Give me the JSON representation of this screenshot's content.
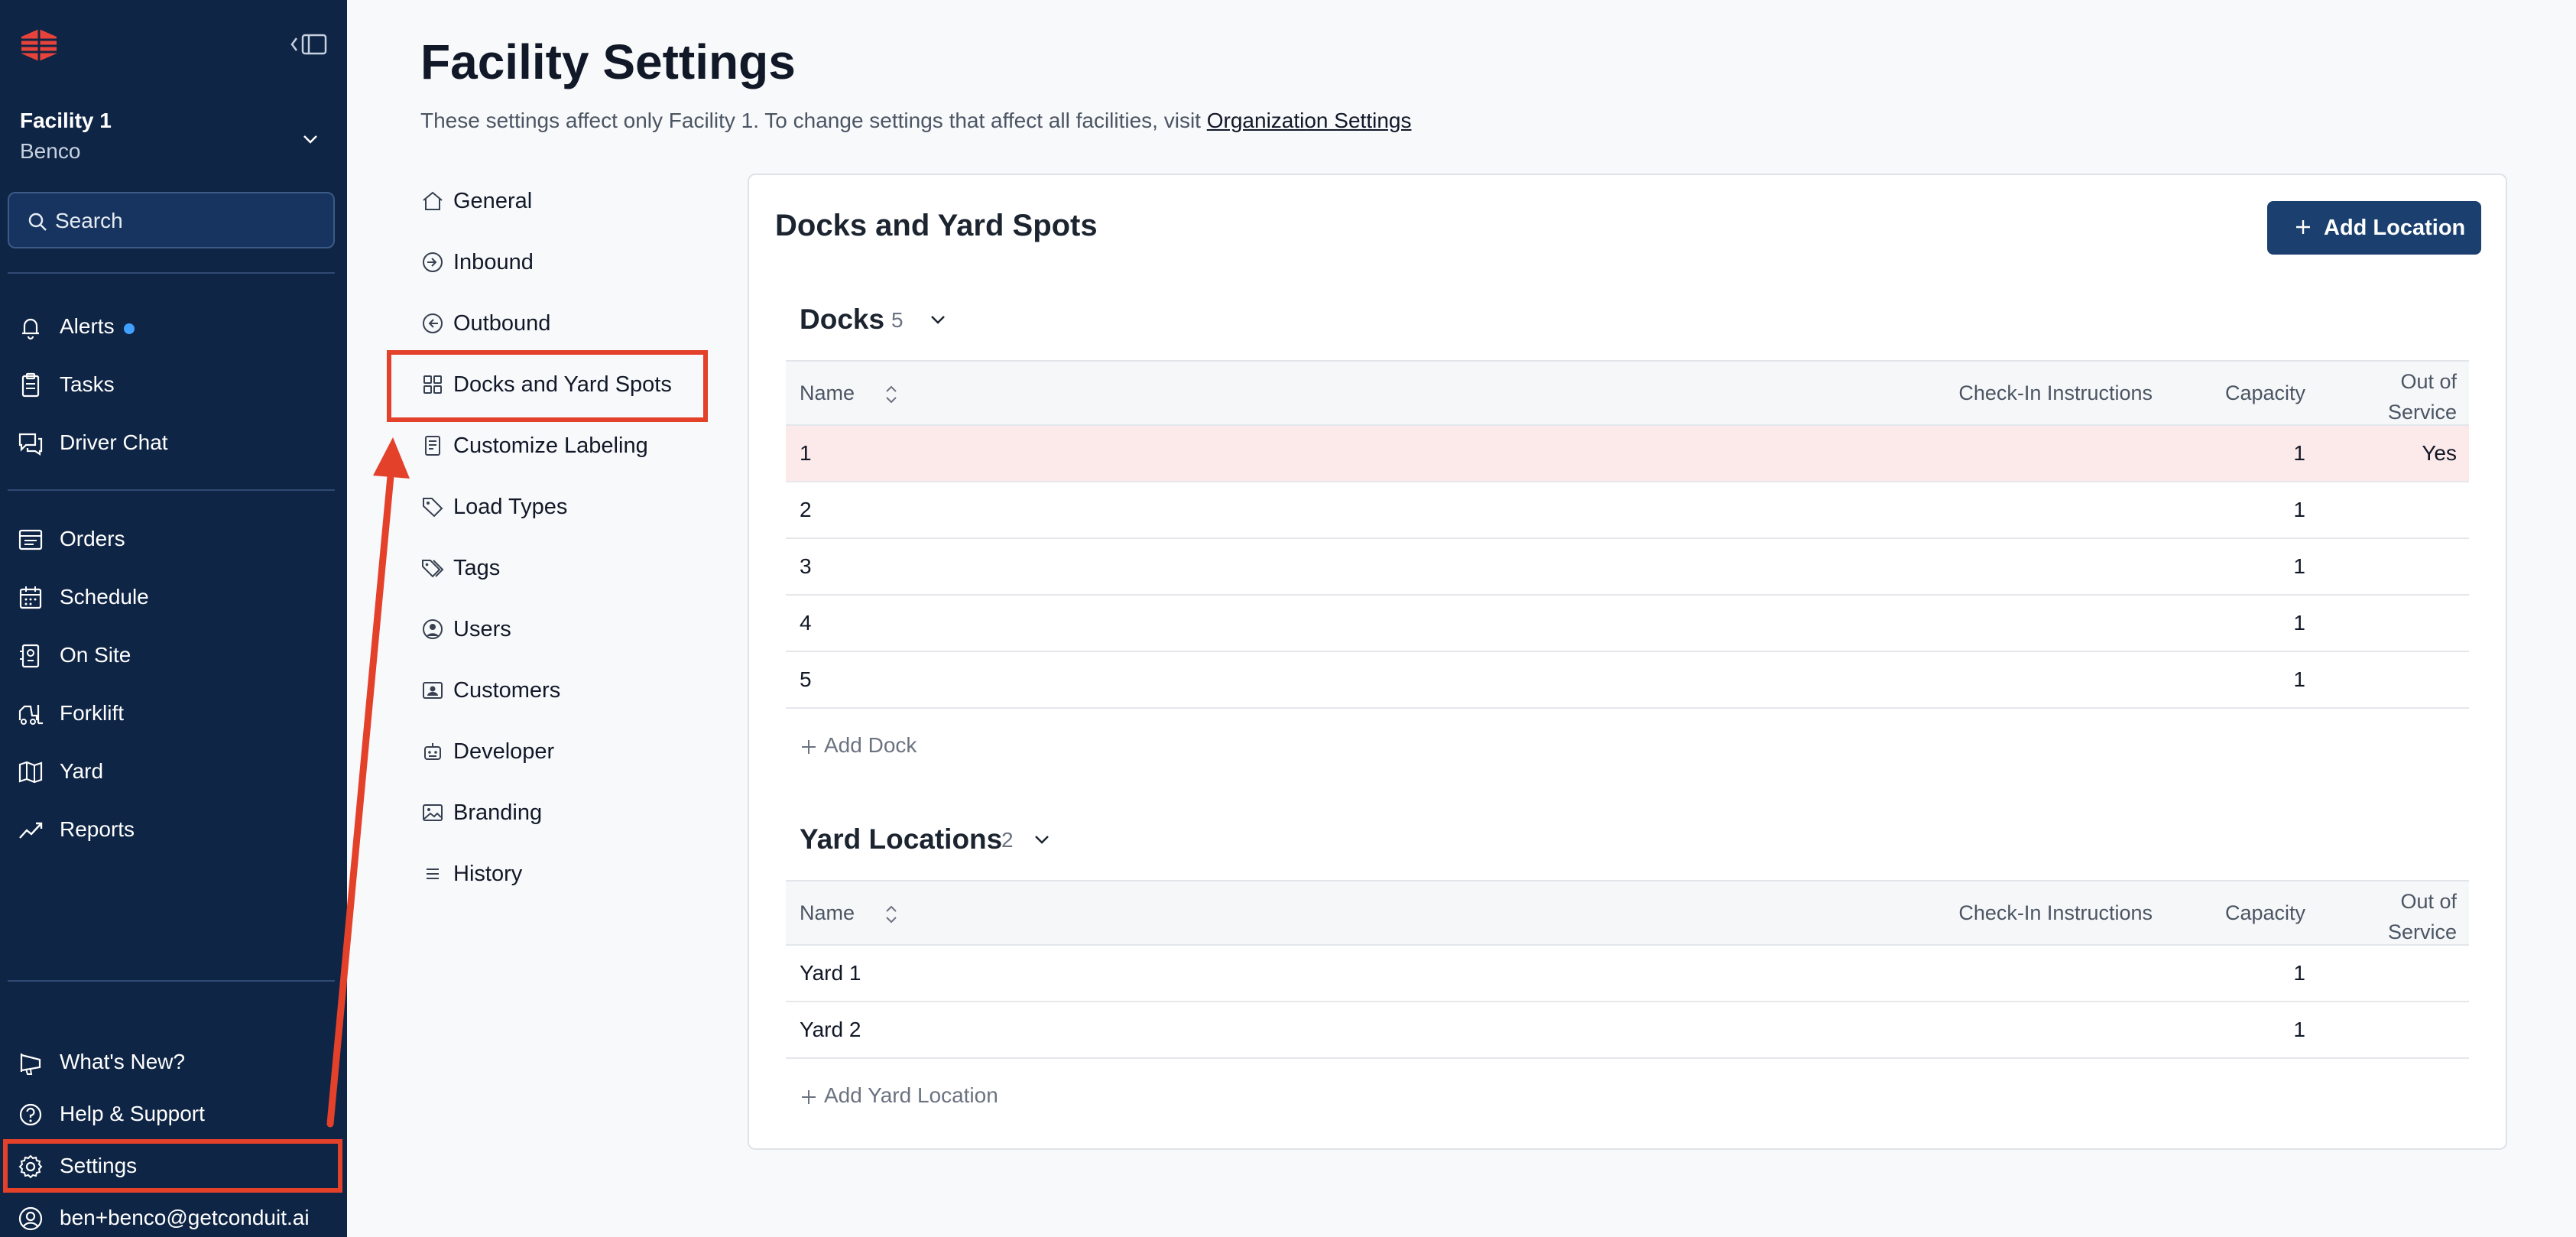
{
  "sidebar": {
    "facility": {
      "name": "Facility 1",
      "org": "Benco"
    },
    "search": {
      "label": "Search"
    },
    "primary_items": [
      {
        "label": "Alerts",
        "icon": "bell-icon",
        "unread_dot": true
      },
      {
        "label": "Tasks",
        "icon": "clipboard-icon"
      },
      {
        "label": "Driver Chat",
        "icon": "chat-icon"
      }
    ],
    "secondary_items": [
      {
        "label": "Orders",
        "icon": "orders-icon"
      },
      {
        "label": "Schedule",
        "icon": "calendar-icon"
      },
      {
        "label": "On Site",
        "icon": "building-icon"
      },
      {
        "label": "Forklift",
        "icon": "forklift-icon"
      },
      {
        "label": "Yard",
        "icon": "map-icon"
      },
      {
        "label": "Reports",
        "icon": "chart-icon"
      }
    ],
    "footer_items": [
      {
        "label": "What's New?",
        "icon": "megaphone-icon"
      },
      {
        "label": "Help & Support",
        "icon": "help-circle-icon"
      },
      {
        "label": "Settings",
        "icon": "gear-icon",
        "highlighted": true
      },
      {
        "label": "ben+benco@getconduit.ai",
        "icon": "user-circle-icon"
      }
    ]
  },
  "page": {
    "title": "Facility Settings",
    "subtitle": "These settings affect only Facility 1. To change settings that affect all facilities, visit",
    "subtitle_link": "Organization Settings"
  },
  "settings_nav": [
    {
      "label": "General",
      "icon": "home-icon"
    },
    {
      "label": "Inbound",
      "icon": "arrow-circle-right-icon"
    },
    {
      "label": "Outbound",
      "icon": "arrow-circle-left-icon"
    },
    {
      "label": "Docks and Yard Spots",
      "icon": "grid-icon",
      "selected": true
    },
    {
      "label": "Customize Labeling",
      "icon": "label-document-icon"
    },
    {
      "label": "Load Types",
      "icon": "tag-icon"
    },
    {
      "label": "Tags",
      "icon": "tags-icon"
    },
    {
      "label": "Users",
      "icon": "user-circle-icon"
    },
    {
      "label": "Customers",
      "icon": "contact-card-icon"
    },
    {
      "label": "Developer",
      "icon": "robot-icon"
    },
    {
      "label": "Branding",
      "icon": "image-icon"
    },
    {
      "label": "History",
      "icon": "list-icon"
    }
  ],
  "card": {
    "title": "Docks and Yard Spots",
    "add_location_label": "Add Location",
    "columns": {
      "name": "Name",
      "check_in": "Check-In Instructions",
      "capacity": "Capacity",
      "out_of_service": "Out of Service"
    },
    "docks": {
      "title": "Docks",
      "count": "5",
      "rows": [
        {
          "name": "1",
          "check_in": "",
          "capacity": "1",
          "out_of_service": "Yes",
          "highlight": true
        },
        {
          "name": "2",
          "check_in": "",
          "capacity": "1",
          "out_of_service": ""
        },
        {
          "name": "3",
          "check_in": "",
          "capacity": "1",
          "out_of_service": ""
        },
        {
          "name": "4",
          "check_in": "",
          "capacity": "1",
          "out_of_service": ""
        },
        {
          "name": "5",
          "check_in": "",
          "capacity": "1",
          "out_of_service": ""
        }
      ],
      "add_label": "Add Dock"
    },
    "yard": {
      "title": "Yard Locations",
      "count": "2",
      "rows": [
        {
          "name": "Yard 1",
          "check_in": "",
          "capacity": "1",
          "out_of_service": ""
        },
        {
          "name": "Yard 2",
          "check_in": "",
          "capacity": "1",
          "out_of_service": ""
        }
      ],
      "add_label": "Add Yard Location"
    }
  },
  "colors": {
    "sidebar_bg": "#0f2545",
    "accent": "#1b3f6e",
    "annotation_red": "#e4412b",
    "highlight_row": "#fce9e9",
    "alert_dot": "#3fa0ff"
  }
}
